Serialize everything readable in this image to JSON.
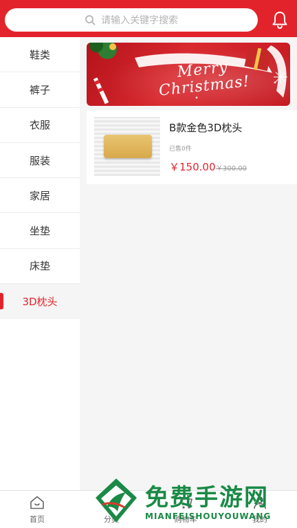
{
  "search": {
    "placeholder": "请输入关键字搜索",
    "icon": "search-icon"
  },
  "header": {
    "notification_icon": "bell-icon"
  },
  "colors": {
    "accent": "#e3232c",
    "watermark_green": "#1a8a46"
  },
  "sidebar": {
    "items": [
      {
        "label": "鞋类"
      },
      {
        "label": "裤子"
      },
      {
        "label": "衣服"
      },
      {
        "label": "服装"
      },
      {
        "label": "家居"
      },
      {
        "label": "坐垫"
      },
      {
        "label": "床垫"
      },
      {
        "label": "3D枕头",
        "active": true
      }
    ]
  },
  "banner": {
    "line1": "Merry",
    "line2": "Christmas!"
  },
  "product": {
    "title": "B款金色3D枕头",
    "sold": "已售0件",
    "price": "￥150.00",
    "original_price": "￥300.00"
  },
  "tabbar": {
    "items": [
      {
        "label": "首页",
        "icon": "home-icon"
      },
      {
        "label": "分类",
        "icon": "category-icon"
      },
      {
        "label": "购物车",
        "icon": "cart-icon"
      },
      {
        "label": "我的",
        "icon": "user-icon"
      }
    ]
  },
  "watermark": {
    "text_cn": "免费手游网",
    "text_en": "MIANFEISHOUYOUWANG"
  }
}
